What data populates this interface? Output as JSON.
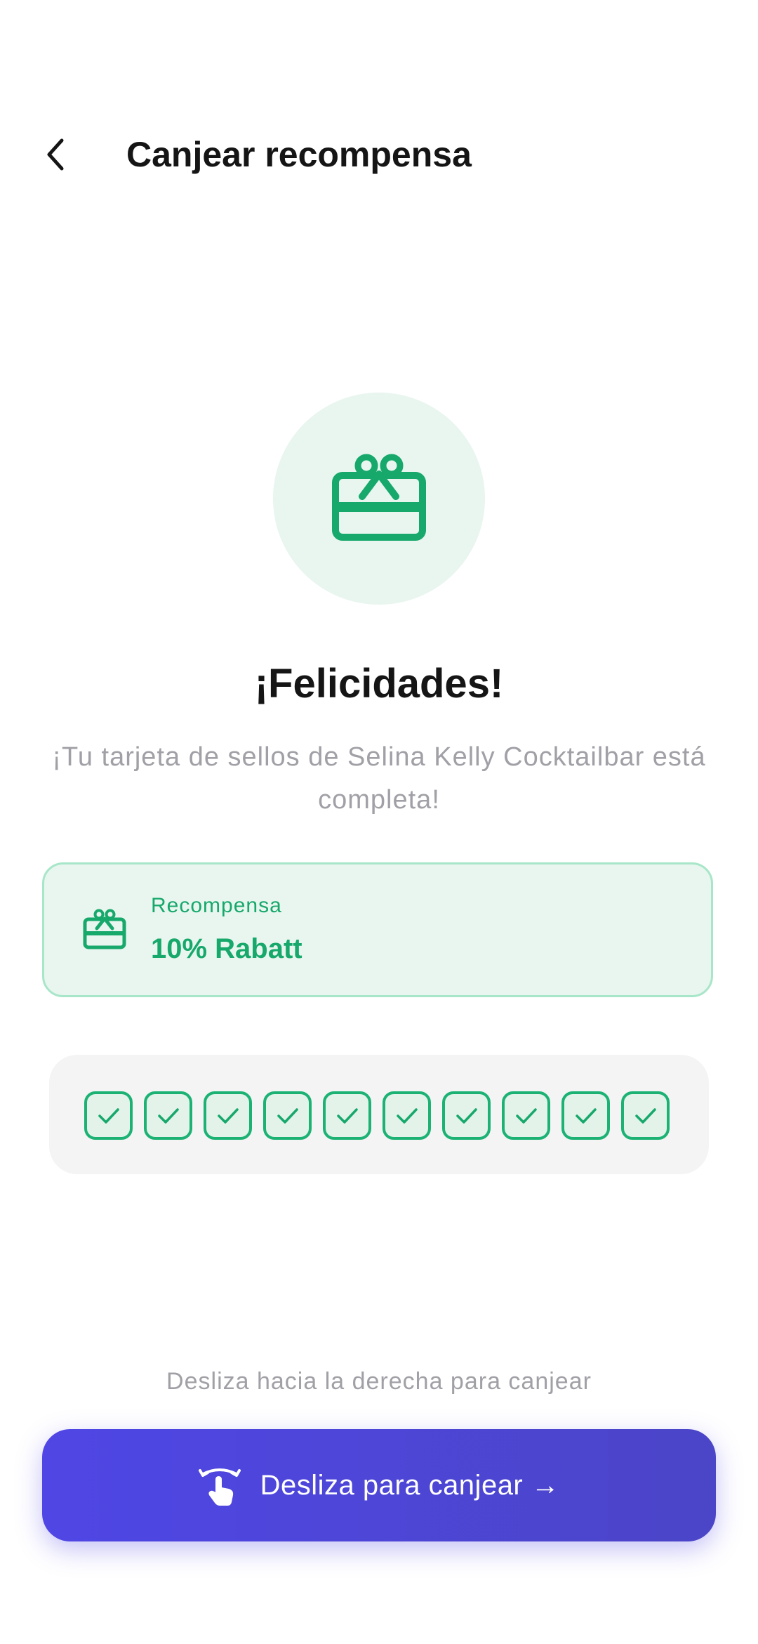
{
  "header": {
    "title": "Canjear recompensa",
    "back_icon": "chevron-left-icon"
  },
  "hero": {
    "icon": "gift-card-icon",
    "circle_color": "#e8f6ef",
    "icon_color": "#17a86b"
  },
  "congrats": {
    "title": "¡Felicidades!",
    "subtitle": "¡Tu tarjeta de sellos de Selina Kelly Cocktailbar está completa!"
  },
  "reward": {
    "icon": "gift-card-icon",
    "label": "Recompensa",
    "value": "10% Rabatt"
  },
  "stamps": {
    "total": 10,
    "filled": 10,
    "icon": "check-icon"
  },
  "redeem": {
    "hint": "Desliza hacia la derecha para canjear",
    "button_label": "Desliza para canjear →",
    "button_icon": "swipe-hand-icon",
    "accent": "#4f46e5"
  }
}
